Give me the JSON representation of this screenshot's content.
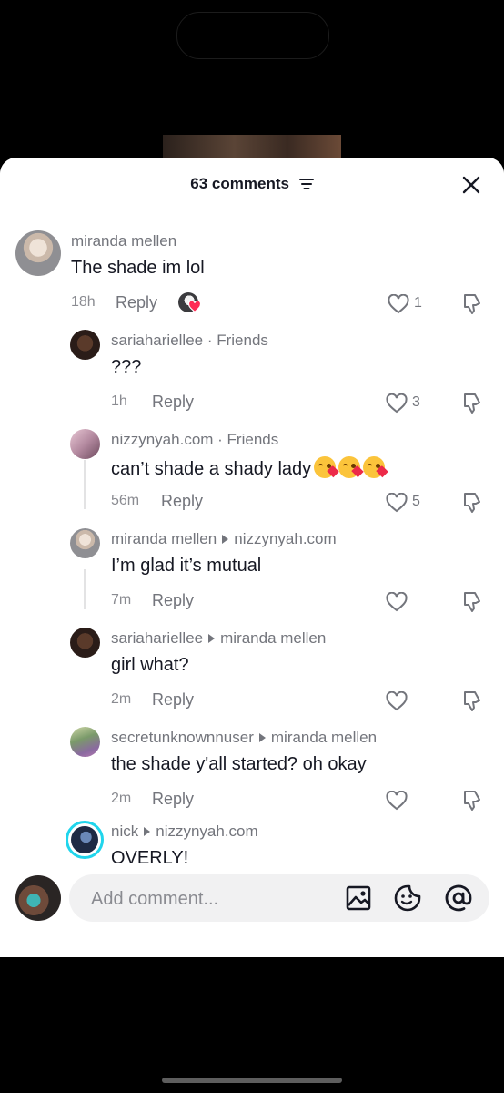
{
  "header": {
    "title": "63 comments"
  },
  "input": {
    "placeholder": "Add comment..."
  },
  "reply_label": "Reply",
  "comments": [
    {
      "id": "c1",
      "username": "miranda mellen",
      "text": "The shade im lol",
      "time": "18h",
      "likes": "1"
    },
    {
      "id": "c2",
      "username": "sariahariellee",
      "tag": " · Friends",
      "text": "???",
      "time": "1h",
      "likes": "3"
    },
    {
      "id": "c3",
      "username": "nizzynyah.com",
      "tag": " · Friends",
      "text": "can’t shade a shady lady",
      "emoji_count": 3,
      "time": "56m",
      "likes": "5"
    },
    {
      "id": "c4",
      "username": "miranda mellen",
      "reply_to": "nizzynyah.com",
      "text": "I’m glad it’s mutual",
      "time": "7m",
      "likes": ""
    },
    {
      "id": "c5",
      "username": "sariahariellee",
      "reply_to": "miranda mellen",
      "text": "girl what?",
      "time": "2m",
      "likes": ""
    },
    {
      "id": "c6",
      "username": "secretunknownnuser",
      "reply_to": "miranda mellen",
      "text": "the shade y'all started? oh okay",
      "time": "2m",
      "likes": ""
    },
    {
      "id": "c7",
      "username": "nick",
      "reply_to": "nizzynyah.com",
      "text": "OVERLY!"
    }
  ],
  "colors": {
    "text": "#161823",
    "secondary": "#73757c",
    "background": "#ffffff",
    "heart_badge": "#fe2c55"
  },
  "icons": [
    "filter-icon",
    "close-icon",
    "heart-icon",
    "dislike-icon",
    "image-icon",
    "sticker-icon",
    "mention-icon"
  ]
}
